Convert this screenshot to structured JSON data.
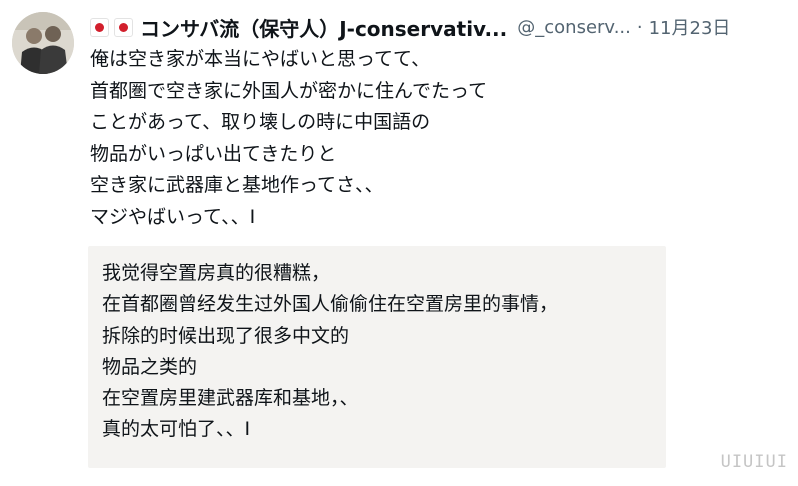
{
  "author": {
    "display_name": "コンサバ流（保守人）J-conservativ...",
    "handle": "@_conserv...",
    "separator": "·",
    "date": "11月23日",
    "flag_icon": "japan-flag-icon",
    "flag_color": "#d21f2c"
  },
  "tweet": {
    "lines": [
      "俺は空き家が本当にやばいと思ってて、",
      "首都圏で空き家に外国人が密かに住んでたって",
      "ことがあって、取り壊しの時に中国語の",
      "物品がいっぱい出てきたりと",
      "空き家に武器庫と基地作ってさ、、",
      "マジやばいって、、I"
    ]
  },
  "translation": {
    "lines": [
      "我觉得空置房真的很糟糕，",
      "在首都圈曾经发生过外国人偷偷住在空置房里的事情，",
      "拆除的时候出现了很多中文的",
      "物品之类的",
      "在空置房里建武器库和基地，、",
      "真的太可怕了、、I"
    ],
    "background": "#f4f3f1"
  },
  "watermark": "UIUIUI"
}
